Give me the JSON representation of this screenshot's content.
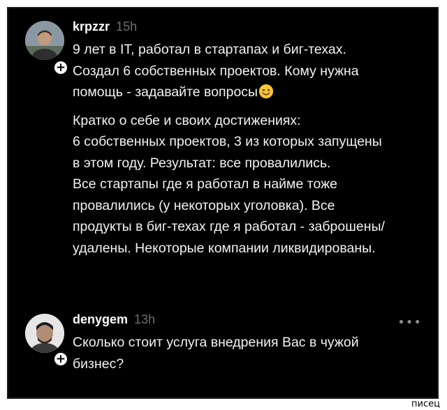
{
  "comments": [
    {
      "username": "krpzzr",
      "time": "15h",
      "avatar_icon": "user-avatar",
      "add_icon": "plus-icon",
      "paragraphs": [
        [
          "9 лет в IT, работал в стартапах и биг-техах.",
          "Создал 6 собственных проектов. Кому нужна",
          "помощь - задавайте вопросы"
        ],
        [
          "Кратко о себе и своих достижениях:",
          "6 собственных проектов, 3 из которых запущены",
          "в этом году. Результат: все провалились.",
          "Все стартапы где я работал в найме тоже",
          "провалились (у некоторых уголовка). Все",
          "продукты в биг-техах где я работал - заброшены/",
          "удалены. Некоторые компании ликвидированы."
        ]
      ],
      "emoji": "smiling-face-emoji"
    },
    {
      "username": "denygem",
      "time": "13h",
      "avatar_icon": "user-avatar",
      "add_icon": "plus-icon",
      "more_label": "•••",
      "lines": [
        "Сколько стоит услуга внедрения Вас в чужой",
        "бизнес?"
      ]
    }
  ],
  "watermark": "писец",
  "colors": {
    "background": "#000000",
    "text": "#f2f2f2",
    "muted": "#6f6f6f",
    "frame": "#ffffff"
  }
}
